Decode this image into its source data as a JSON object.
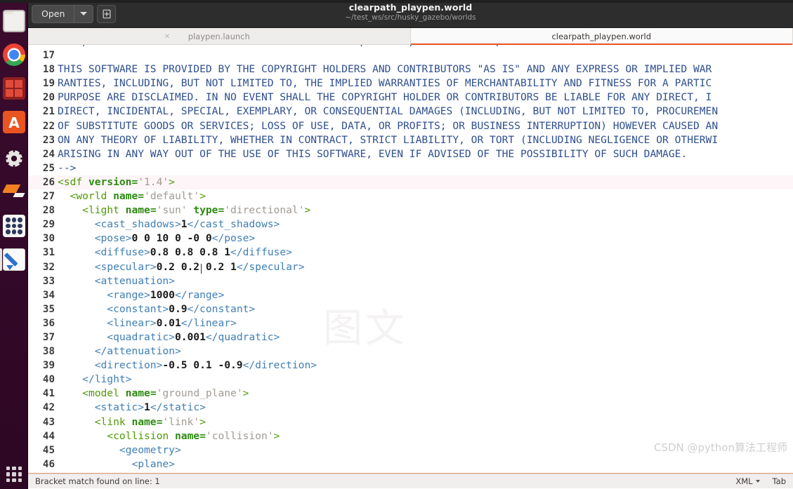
{
  "window": {
    "title": "clearpath_playpen.world",
    "subtitle": "~/test_ws/src/husky_gazebo/worlds",
    "open_button": "Open",
    "open_caret_icon": "chevron-down-icon",
    "new_document_icon": "new-document-icon"
  },
  "tabs": [
    {
      "label": "playpen.launch",
      "active": false,
      "close_icon": "close-icon"
    },
    {
      "label": "clearpath_playpen.world",
      "active": true,
      "close_icon": "close-icon"
    }
  ],
  "launcher": {
    "items": [
      {
        "name": "files",
        "icon": "folder-icon"
      },
      {
        "name": "chrome",
        "icon": "chrome-icon"
      },
      {
        "name": "media-app",
        "icon": "red-tiles-icon"
      },
      {
        "name": "ubuntu-software",
        "icon": "ubuntu-software-icon",
        "glyph": "A"
      },
      {
        "name": "system-settings",
        "icon": "gear-icon"
      },
      {
        "name": "gazebo",
        "icon": "gazebo-diamond-icon"
      },
      {
        "name": "app-grid",
        "icon": "grid-icon"
      },
      {
        "name": "text-editor",
        "icon": "gedit-pencil-icon"
      },
      {
        "name": "show-applications",
        "icon": "dots-grid-icon"
      }
    ]
  },
  "statusbar": {
    "message": "Bracket match found on line: 1",
    "language": "XML",
    "language_caret_icon": "chevron-down-icon",
    "indent": "Tab"
  },
  "watermark": "CSDN @python算法工程师",
  "ghost_watermark": "图文",
  "editor": {
    "language": "XML",
    "lines": [
      {
        "n": "16",
        "tokens": [
          {
            "c": "cmt",
            "t": "    products derived from this software without specific prior written permission."
          }
        ]
      },
      {
        "n": "17",
        "tokens": [
          {
            "c": "cmt",
            "t": ""
          }
        ]
      },
      {
        "n": "18",
        "tokens": [
          {
            "c": "cmt",
            "t": "THIS SOFTWARE IS PROVIDED BY THE COPYRIGHT HOLDERS AND CONTRIBUTORS \"AS IS\" AND ANY EXPRESS OR IMPLIED WAR"
          }
        ]
      },
      {
        "n": "19",
        "tokens": [
          {
            "c": "cmt",
            "t": "RANTIES, INCLUDING, BUT NOT LIMITED TO, THE IMPLIED WARRANTIES OF MERCHANTABILITY AND FITNESS FOR A PARTIC"
          }
        ]
      },
      {
        "n": "20",
        "tokens": [
          {
            "c": "cmt",
            "t": "PURPOSE ARE DISCLAIMED. IN NO EVENT SHALL THE COPYRIGHT HOLDER OR CONTRIBUTORS BE LIABLE FOR ANY DIRECT, I"
          }
        ]
      },
      {
        "n": "21",
        "tokens": [
          {
            "c": "cmt",
            "t": "DIRECT, INCIDENTAL, SPECIAL, EXEMPLARY, OR CONSEQUENTIAL DAMAGES (INCLUDING, BUT NOT LIMITED TO, PROCUREMEN"
          }
        ]
      },
      {
        "n": "22",
        "tokens": [
          {
            "c": "cmt",
            "t": "OF SUBSTITUTE GOODS OR SERVICES; LOSS OF USE, DATA, OR PROFITS; OR BUSINESS INTERRUPTION) HOWEVER CAUSED AN"
          }
        ]
      },
      {
        "n": "23",
        "tokens": [
          {
            "c": "cmt",
            "t": "ON ANY THEORY OF LIABILITY, WHETHER IN CONTRACT, STRICT LIABILITY, OR TORT (INCLUDING NEGLIGENCE OR OTHERWI"
          }
        ]
      },
      {
        "n": "24",
        "tokens": [
          {
            "c": "cmt",
            "t": "ARISING IN ANY WAY OUT OF THE USE OF THIS SOFTWARE, EVEN IF ADVISED OF THE POSSIBILITY OF SUCH DAMAGE."
          }
        ]
      },
      {
        "n": "25",
        "tokens": [
          {
            "c": "cmt",
            "t": "-->"
          }
        ]
      },
      {
        "n": "26",
        "hl": true,
        "tokens": [
          {
            "c": "tg",
            "t": "<sdf "
          },
          {
            "c": "at",
            "t": "version="
          },
          {
            "c": "av",
            "t": "'1.4'"
          },
          {
            "c": "tg",
            "t": ">"
          }
        ]
      },
      {
        "n": "27",
        "tokens": [
          {
            "c": "plain",
            "t": "  "
          },
          {
            "c": "tg",
            "t": "<world "
          },
          {
            "c": "at",
            "t": "name="
          },
          {
            "c": "av",
            "t": "'default'"
          },
          {
            "c": "tg",
            "t": ">"
          }
        ]
      },
      {
        "n": "28",
        "tokens": [
          {
            "c": "plain",
            "t": "    "
          },
          {
            "c": "tg",
            "t": "<light "
          },
          {
            "c": "at",
            "t": "name="
          },
          {
            "c": "av",
            "t": "'sun' "
          },
          {
            "c": "at",
            "t": "type="
          },
          {
            "c": "av",
            "t": "'directional'"
          },
          {
            "c": "tg",
            "t": ">"
          }
        ]
      },
      {
        "n": "29",
        "tokens": [
          {
            "c": "plain",
            "t": "      "
          },
          {
            "c": "tg2",
            "t": "<cast_shadows>"
          },
          {
            "c": "num",
            "t": "1"
          },
          {
            "c": "tg2",
            "t": "</cast_shadows>"
          }
        ]
      },
      {
        "n": "30",
        "tokens": [
          {
            "c": "plain",
            "t": "      "
          },
          {
            "c": "tg2",
            "t": "<pose>"
          },
          {
            "c": "num",
            "t": "0 0 10 0 -0 0"
          },
          {
            "c": "tg2",
            "t": "</pose>"
          }
        ]
      },
      {
        "n": "31",
        "tokens": [
          {
            "c": "plain",
            "t": "      "
          },
          {
            "c": "tg2",
            "t": "<diffuse>"
          },
          {
            "c": "num",
            "t": "0.8 0.8 0.8 1"
          },
          {
            "c": "tg2",
            "t": "</diffuse>"
          }
        ]
      },
      {
        "n": "32",
        "tokens": [
          {
            "c": "plain",
            "t": "      "
          },
          {
            "c": "tg2",
            "t": "<specular>"
          },
          {
            "c": "num",
            "t": "0.2 0.2 0.2 1"
          },
          {
            "c": "tg2",
            "t": "</specular>"
          }
        ]
      },
      {
        "n": "33",
        "tokens": [
          {
            "c": "plain",
            "t": "      "
          },
          {
            "c": "tg2",
            "t": "<attenuation>"
          }
        ]
      },
      {
        "n": "34",
        "tokens": [
          {
            "c": "plain",
            "t": "        "
          },
          {
            "c": "tg2",
            "t": "<range>"
          },
          {
            "c": "num",
            "t": "1000"
          },
          {
            "c": "tg2",
            "t": "</range>"
          }
        ]
      },
      {
        "n": "35",
        "tokens": [
          {
            "c": "plain",
            "t": "        "
          },
          {
            "c": "tg2",
            "t": "<constant>"
          },
          {
            "c": "num",
            "t": "0.9"
          },
          {
            "c": "tg2",
            "t": "</constant>"
          }
        ]
      },
      {
        "n": "36",
        "tokens": [
          {
            "c": "plain",
            "t": "        "
          },
          {
            "c": "tg2",
            "t": "<linear>"
          },
          {
            "c": "num",
            "t": "0.01"
          },
          {
            "c": "tg2",
            "t": "</linear>"
          }
        ]
      },
      {
        "n": "37",
        "tokens": [
          {
            "c": "plain",
            "t": "        "
          },
          {
            "c": "tg2",
            "t": "<quadratic>"
          },
          {
            "c": "num",
            "t": "0.001"
          },
          {
            "c": "tg2",
            "t": "</quadratic>"
          }
        ]
      },
      {
        "n": "38",
        "tokens": [
          {
            "c": "plain",
            "t": "      "
          },
          {
            "c": "tg2",
            "t": "</attenuation>"
          }
        ]
      },
      {
        "n": "39",
        "tokens": [
          {
            "c": "plain",
            "t": "      "
          },
          {
            "c": "tg2",
            "t": "<direction>"
          },
          {
            "c": "num",
            "t": "-0.5 0.1 -0.9"
          },
          {
            "c": "tg2",
            "t": "</direction>"
          }
        ]
      },
      {
        "n": "40",
        "tokens": [
          {
            "c": "plain",
            "t": "    "
          },
          {
            "c": "tg2",
            "t": "</light>"
          }
        ]
      },
      {
        "n": "41",
        "tokens": [
          {
            "c": "plain",
            "t": "    "
          },
          {
            "c": "tg",
            "t": "<model "
          },
          {
            "c": "at",
            "t": "name="
          },
          {
            "c": "av",
            "t": "'ground_plane'"
          },
          {
            "c": "tg",
            "t": ">"
          }
        ]
      },
      {
        "n": "42",
        "tokens": [
          {
            "c": "plain",
            "t": "      "
          },
          {
            "c": "tg2",
            "t": "<static>"
          },
          {
            "c": "num",
            "t": "1"
          },
          {
            "c": "tg2",
            "t": "</static>"
          }
        ]
      },
      {
        "n": "43",
        "tokens": [
          {
            "c": "plain",
            "t": "      "
          },
          {
            "c": "tg",
            "t": "<link "
          },
          {
            "c": "at",
            "t": "name="
          },
          {
            "c": "av",
            "t": "'link'"
          },
          {
            "c": "tg",
            "t": ">"
          }
        ]
      },
      {
        "n": "44",
        "tokens": [
          {
            "c": "plain",
            "t": "        "
          },
          {
            "c": "tg",
            "t": "<collision "
          },
          {
            "c": "at",
            "t": "name="
          },
          {
            "c": "av",
            "t": "'collision'"
          },
          {
            "c": "tg",
            "t": ">"
          }
        ]
      },
      {
        "n": "45",
        "tokens": [
          {
            "c": "plain",
            "t": "          "
          },
          {
            "c": "tg2",
            "t": "<geometry>"
          }
        ]
      },
      {
        "n": "46",
        "tokens": [
          {
            "c": "plain",
            "t": "            "
          },
          {
            "c": "tg2",
            "t": "<plane>"
          }
        ]
      }
    ]
  },
  "colors": {
    "accent": "#e95420",
    "titlebar": "#2d2d2d",
    "launcher": "#35092a",
    "comment": "#2f4f8f",
    "tag": "#4e9a06",
    "tag_alt": "#3f7fb5",
    "attribute": "#2e8b12",
    "attr_value": "#a09a93"
  }
}
